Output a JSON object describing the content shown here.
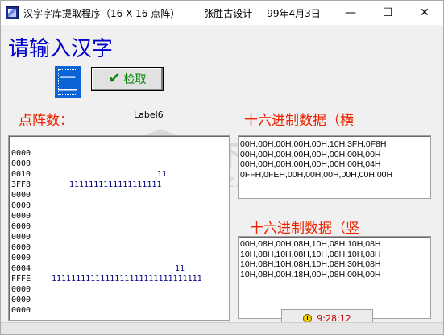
{
  "window": {
    "title": "汉字字库提取程序（16 X 16 点阵）_____张胜古设计___99年4月3日",
    "min_glyph": "—",
    "max_glyph": "☐",
    "close_glyph": "✕"
  },
  "heading": "请输入汉字",
  "input": {
    "value": "二"
  },
  "query_button": {
    "label": "检取",
    "icon": "check-icon"
  },
  "labels": {
    "dot_matrix": "点阵数：",
    "label6": "Label6",
    "hex_horizontal": "十六进制数据（横",
    "hex_vertical": "十六进制数据（竖"
  },
  "dot_matrix": {
    "rows": [
      {
        "code": "",
        "bits": ""
      },
      {
        "code": "0000",
        "bits": ""
      },
      {
        "code": "0000",
        "bits": ""
      },
      {
        "code": "0010",
        "bits": "11"
      },
      {
        "code": "3FF8",
        "bits": "1111111111111111111"
      },
      {
        "code": "0000",
        "bits": ""
      },
      {
        "code": "0000",
        "bits": ""
      },
      {
        "code": "0000",
        "bits": ""
      },
      {
        "code": "0000",
        "bits": ""
      },
      {
        "code": "0000",
        "bits": ""
      },
      {
        "code": "0000",
        "bits": ""
      },
      {
        "code": "0000",
        "bits": ""
      },
      {
        "code": "0004",
        "bits": "11"
      },
      {
        "code": "FFFE",
        "bits": "1111111111111111111111111111111"
      },
      {
        "code": "0000",
        "bits": ""
      },
      {
        "code": "0000",
        "bits": ""
      },
      {
        "code": "0000",
        "bits": ""
      }
    ]
  },
  "hex_horizontal": {
    "lines": [
      "00H,00H,00H,00H,00H,10H,3FH,0F8H",
      "00H,00H,00H,00H,00H,00H,00H,00H",
      "00H,00H,00H,00H,00H,00H,00H,04H",
      "0FFH,0FEH,00H,00H,00H,00H,00H,00H"
    ]
  },
  "hex_vertical": {
    "lines": [
      "00H,08H,00H,08H,10H,08H,10H,08H",
      "10H,08H,10H,08H,10H,08H,10H,08H",
      "10H,08H,10H,08H,10H,08H,30H,08H",
      "10H,08H,00H,18H,00H,08H,00H,00H"
    ]
  },
  "status": {
    "time": "9:28:12",
    "icon": "clock-icon"
  },
  "watermark": {
    "text": "安下载",
    "sub": "anxz.com"
  }
}
